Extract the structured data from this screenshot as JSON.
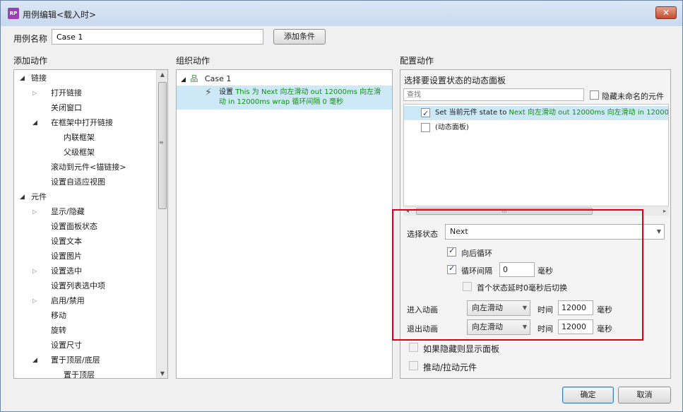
{
  "window": {
    "title": "用例编辑<载入时>",
    "app_icon": "RP",
    "close_glyph": "✕"
  },
  "case": {
    "label": "用例名称",
    "value": "Case 1",
    "add_condition": "添加条件"
  },
  "sections": {
    "add": "添加动作",
    "organize": "组织动作",
    "config": "配置动作"
  },
  "actions_tree": [
    {
      "text": "链接",
      "expander": "down"
    },
    {
      "text": "打开链接",
      "expander": "right"
    },
    {
      "text": "关闭窗口",
      "expander": "none"
    },
    {
      "text": "在框架中打开链接",
      "expander": "down"
    },
    {
      "text": "内联框架",
      "expander": "none"
    },
    {
      "text": "父级框架",
      "expander": "none"
    },
    {
      "text": "滚动到元件<锚链接>",
      "expander": "none"
    },
    {
      "text": "设置自适应视图",
      "expander": "none"
    },
    {
      "text": "元件",
      "expander": "down"
    },
    {
      "text": "显示/隐藏",
      "expander": "right"
    },
    {
      "text": "设置面板状态",
      "expander": "none"
    },
    {
      "text": "设置文本",
      "expander": "none"
    },
    {
      "text": "设置图片",
      "expander": "none"
    },
    {
      "text": "设置选中",
      "expander": "right"
    },
    {
      "text": "设置列表选中项",
      "expander": "none"
    },
    {
      "text": "启用/禁用",
      "expander": "right"
    },
    {
      "text": "移动",
      "expander": "none"
    },
    {
      "text": "旋转",
      "expander": "none"
    },
    {
      "text": "设置尺寸",
      "expander": "none"
    },
    {
      "text": "置于顶层/底层",
      "expander": "down"
    },
    {
      "text": "置于顶层",
      "expander": "none"
    }
  ],
  "organize": {
    "case_name": "Case 1",
    "action_prefix": "设置",
    "action_line1": "This 为 Next 向左滑动 out 12000ms 向左滑",
    "action_line2": "动 in 12000ms wrap 循环间隔 0 毫秒"
  },
  "config": {
    "panel_select_title": "选择要设置状态的动态面板",
    "search_placeholder": "查找",
    "hide_unnamed": "隐藏未命名的元件",
    "panel_rows": [
      {
        "prefix": "Set 当前元件 state to",
        "suffix": "Next 向左滑动 out 12000ms 向左滑动 in 12000",
        "checked": true
      },
      {
        "prefix": "(动态面板)",
        "suffix": "",
        "checked": false
      }
    ],
    "state_label": "选择状态",
    "state_value": "Next",
    "wrap": "向后循环",
    "interval": "循环间隔",
    "interval_value": "0",
    "ms": "毫秒",
    "first_delay": "首个状态延时0毫秒后切换",
    "enter_anim": "进入动画",
    "exit_anim": "退出动画",
    "anim_value": "向左滑动",
    "time": "时间",
    "enter_time": "12000",
    "exit_time": "12000",
    "show_if_hidden": "如果隐藏则显示面板",
    "push_pull": "推动/拉动元件"
  },
  "buttons": {
    "ok": "确定",
    "cancel": "取消"
  },
  "colors": {
    "highlight": "#cde8f7",
    "action_green": "#109010",
    "annotation_red": "#d9001b"
  }
}
